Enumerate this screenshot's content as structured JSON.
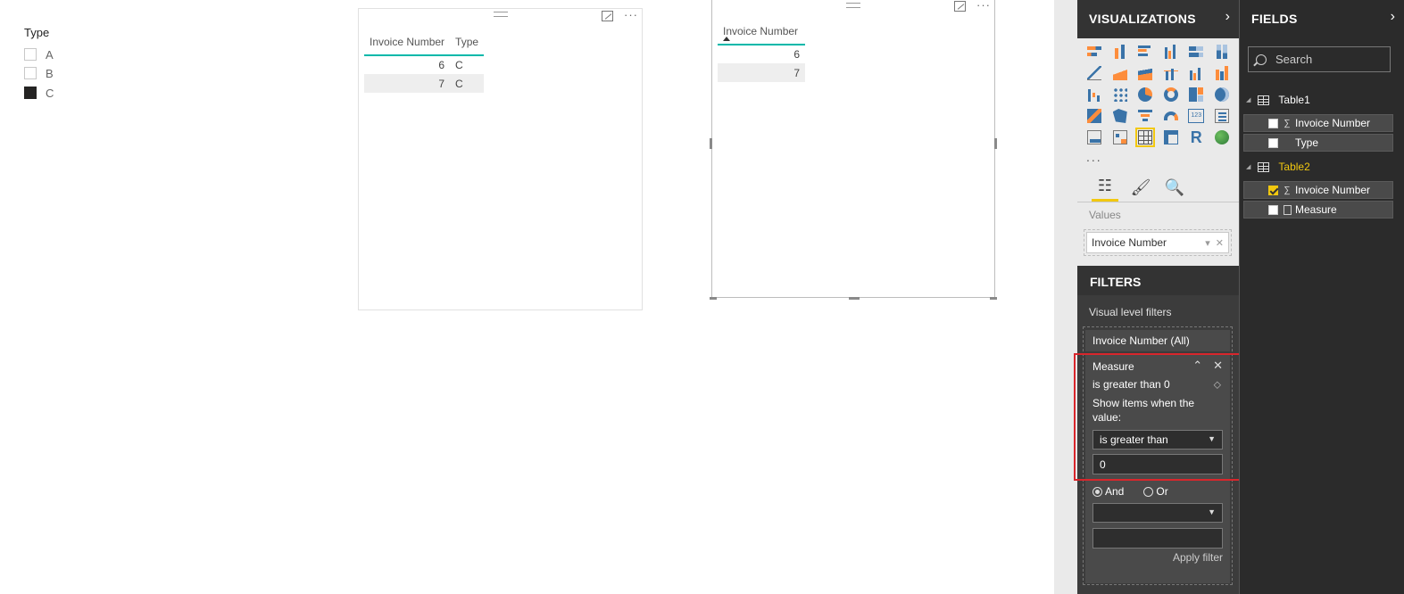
{
  "slicer": {
    "title": "Type",
    "items": [
      {
        "label": "A",
        "checked": false
      },
      {
        "label": "B",
        "checked": false
      },
      {
        "label": "C",
        "checked": true
      }
    ]
  },
  "visual1": {
    "headers": [
      "Invoice Number",
      "Type"
    ],
    "rows": [
      [
        "6",
        "C"
      ],
      [
        "7",
        "C"
      ]
    ]
  },
  "visual2": {
    "headers": [
      "Invoice Number"
    ],
    "rows": [
      [
        "6"
      ],
      [
        "7"
      ]
    ]
  },
  "visualizations": {
    "title": "VISUALIZATIONS",
    "more": "...",
    "values_label": "Values",
    "values_field": "Invoice Number"
  },
  "filters": {
    "title": "FILTERS",
    "visual_level_label": "Visual level filters",
    "invoice_filter": "Invoice Number (All)",
    "measure": {
      "title": "Measure",
      "summary": "is greater than 0",
      "show_items": "Show items when the value:",
      "condition1": "is greater than",
      "value1": "0",
      "and_label": "And",
      "or_label": "Or",
      "condition2": "",
      "value2": "",
      "apply_label": "Apply filter"
    }
  },
  "fields": {
    "title": "FIELDS",
    "search_placeholder": "Search",
    "tables": [
      {
        "name": "Table1",
        "highlight": false,
        "fields": [
          {
            "name": "Invoice Number",
            "type": "sum",
            "checked": false
          },
          {
            "name": "Type",
            "type": "text",
            "checked": false
          }
        ]
      },
      {
        "name": "Table2",
        "highlight": true,
        "fields": [
          {
            "name": "Invoice Number",
            "type": "sum",
            "checked": true
          },
          {
            "name": "Measure",
            "type": "calc",
            "checked": false
          }
        ]
      }
    ]
  },
  "colors": {
    "accent": "#f2c80f",
    "header_underline": "#01b8aa",
    "highlight_box": "#d9262c"
  }
}
